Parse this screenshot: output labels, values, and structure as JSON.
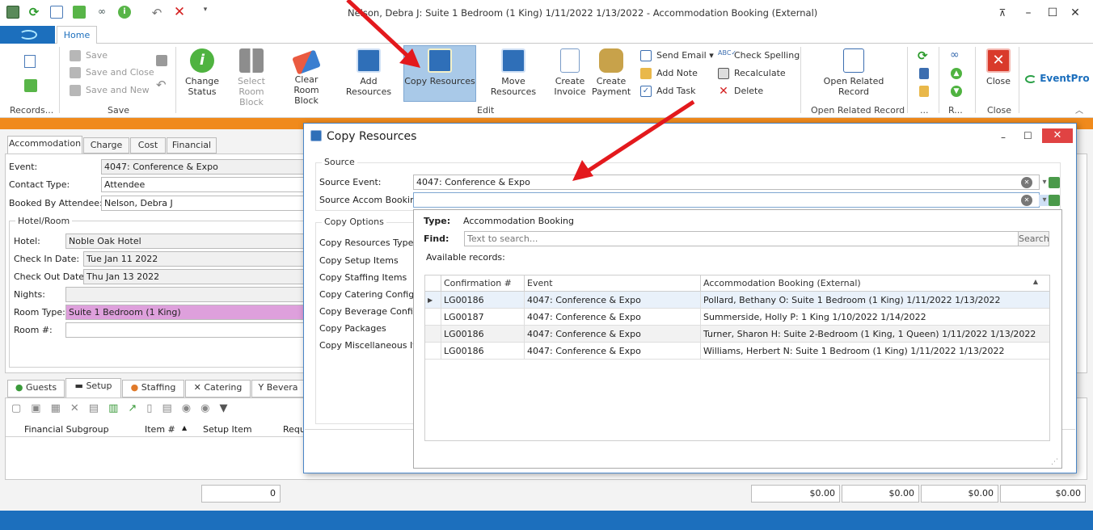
{
  "window": {
    "title": "Nelson, Debra J: Suite 1 Bedroom (1 King) 1/11/2022 1/13/2022  - Accommodation Booking (External)"
  },
  "ribbon": {
    "tab_home": "Home",
    "records_group": "Records...",
    "save": "Save",
    "save_and_close": "Save and Close",
    "save_and_new": "Save and New",
    "save_group": "Save",
    "change_status": "Change Status",
    "select_room_block": "Select Room Block",
    "clear_room_block": "Clear Room Block",
    "add_resources": "Add Resources",
    "copy_resources": "Copy Resources",
    "move_resources": "Move Resources",
    "create_invoice": "Create Invoice",
    "create_payment": "Create Payment",
    "send_email": "Send Email",
    "add_note": "Add Note",
    "add_task": "Add Task",
    "check_spelling": "Check Spelling",
    "recalculate": "Recalculate",
    "delete": "Delete",
    "edit_group": "Edit",
    "open_related_record": "Open Related Record",
    "open_related_group": "Open Related Record",
    "dots_group": "...",
    "r_group": "R...",
    "close": "Close",
    "close_group": "Close",
    "brand": "EventPro"
  },
  "form": {
    "tabs": [
      "Accommodation",
      "Charge",
      "Cost",
      "Financial"
    ],
    "event_label": "Event:",
    "event_value": "4047: Conference & Expo",
    "contact_type_label": "Contact Type:",
    "contact_type_value": "Attendee",
    "booked_by_label": "Booked By Attendee:*",
    "booked_by_value": "Nelson, Debra J",
    "hotel_room_group": "Hotel/Room",
    "hotel_label": "Hotel:",
    "hotel_value": "Noble Oak Hotel",
    "check_in_label": "Check In Date:",
    "check_in_value": "Tue Jan 11 2022",
    "check_out_label": "Check Out Date:",
    "check_out_value": "Thu Jan 13 2022",
    "nights_label": "Nights:",
    "room_type_label": "Room Type:",
    "room_type_value": "Suite 1 Bedroom (1 King)",
    "room_num_label": "Room #:"
  },
  "lower_tabs": [
    "Guests",
    "Setup",
    "Staffing",
    "Catering",
    "Bevera"
  ],
  "setup_grid": {
    "columns": [
      "Financial Subgroup",
      "Item #",
      "Setup Item",
      "Requ"
    ]
  },
  "totals": {
    "count": "0",
    "amounts": [
      "$0.00",
      "$0.00",
      "$0.00",
      "$0.00"
    ]
  },
  "dialog": {
    "title": "Copy Resources",
    "source_group": "Source",
    "source_event_label": "Source Event:",
    "source_event_value": "4047: Conference & Expo",
    "source_accom_label": "Source Accom Booking:",
    "copy_options_group": "Copy Options",
    "options": [
      "Copy Resources Type:",
      "Copy Setup Items",
      "Copy Staffing Items",
      "Copy Catering Configs",
      "Copy Beverage Configs",
      "Copy Packages",
      "Copy Miscellaneous Item"
    ]
  },
  "popup": {
    "type_label": "Type:",
    "type_value": "Accommodation Booking",
    "find_label": "Find:",
    "find_placeholder": "Text to search...",
    "search_button": "Search",
    "available_label": "Available records:",
    "columns": [
      "Confirmation #",
      "Event",
      "Accommodation Booking (External)"
    ],
    "rows": [
      [
        "LG00186",
        "4047: Conference & Expo",
        "Pollard, Bethany O: Suite 1 Bedroom (1 King) 1/11/2022 1/13/2022"
      ],
      [
        "LG00187",
        "4047: Conference & Expo",
        "Summerside, Holly P: 1 King 1/10/2022 1/14/2022"
      ],
      [
        "LG00186",
        "4047: Conference & Expo",
        "Turner, Sharon H: Suite 2-Bedroom (1 King, 1 Queen) 1/11/2022 1/13/2022"
      ],
      [
        "LG00186",
        "4047: Conference & Expo",
        "Williams, Herbert N: Suite 1 Bedroom (1 King) 1/11/2022 1/13/2022"
      ]
    ]
  },
  "colors": {
    "accent_blue": "#1c6fbd",
    "orange_bar": "#f08a1c",
    "annotation_red": "#e3191d",
    "room_type_bg": "#dea0dc",
    "selected_ribbon": "#a9c9e8"
  }
}
